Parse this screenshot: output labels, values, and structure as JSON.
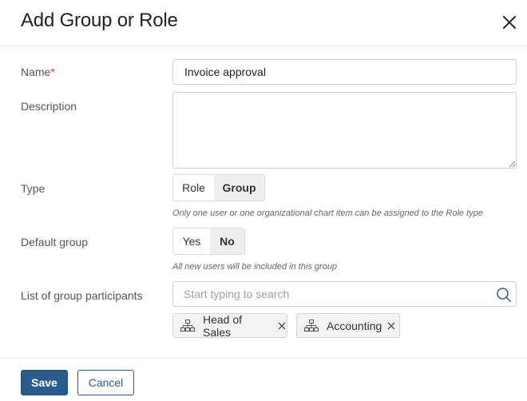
{
  "dialog": {
    "title": "Add Group or Role"
  },
  "form": {
    "name": {
      "label": "Name",
      "required_mark": "*",
      "value": "Invoice approval"
    },
    "description": {
      "label": "Description",
      "value": ""
    },
    "type": {
      "label": "Type",
      "options": [
        "Role",
        "Group"
      ],
      "selected": "Group",
      "hint": "Only one user or one organizational chart item can be assigned to the Role type"
    },
    "default_group": {
      "label": "Default group",
      "options": [
        "Yes",
        "No"
      ],
      "selected": "No",
      "hint": "All new users will be included in this group"
    },
    "participants": {
      "label": "List of group participants",
      "search_placeholder": "Start typing to search",
      "chips": [
        {
          "label": "Head of Sales",
          "icon": "org-chart-icon"
        },
        {
          "label": "Accounting",
          "icon": "org-chart-icon"
        }
      ]
    }
  },
  "footer": {
    "save_label": "Save",
    "cancel_label": "Cancel"
  },
  "colors": {
    "primary": "#2a5c8b",
    "required": "#d9342b",
    "selected_segment_bg": "#eeeeee"
  }
}
